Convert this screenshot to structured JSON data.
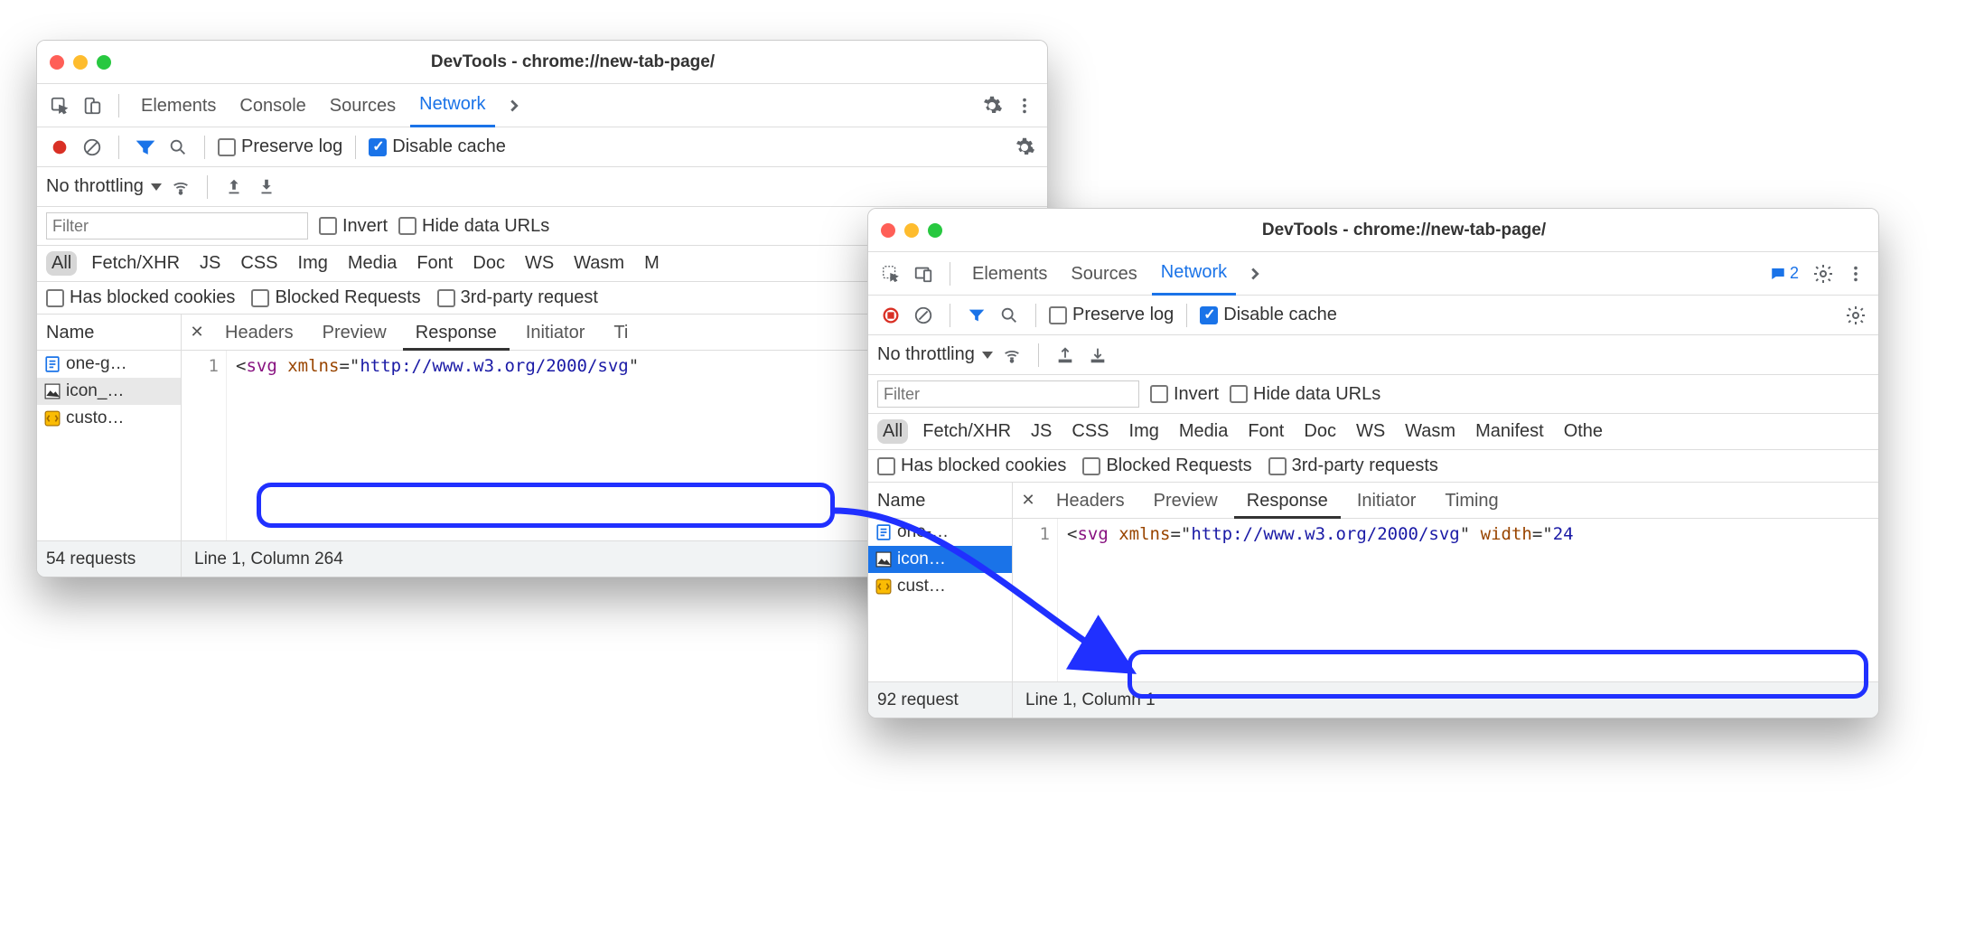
{
  "windows": {
    "a": {
      "title": "DevTools - chrome://new-tab-page/",
      "tabs": {
        "elements": "Elements",
        "console": "Console",
        "sources": "Sources",
        "network": "Network"
      },
      "preserve_log": "Preserve log",
      "disable_cache": "Disable cache",
      "no_throttling": "No throttling",
      "invert": "Invert",
      "hide_data_urls": "Hide data URLs",
      "filter_placeholder": "Filter",
      "types": {
        "all": "All",
        "fetch": "Fetch/XHR",
        "js": "JS",
        "css": "CSS",
        "img": "Img",
        "media": "Media",
        "font": "Font",
        "doc": "Doc",
        "ws": "WS",
        "wasm": "Wasm",
        "m": "M"
      },
      "blocked_cookies": "Has blocked cookies",
      "blocked_requests": "Blocked Requests",
      "third_party": "3rd-party request",
      "name_header": "Name",
      "requests": [
        {
          "label": "one-g…",
          "kind": "doc"
        },
        {
          "label": "icon_…",
          "kind": "pen",
          "selected": true
        },
        {
          "label": "custo…",
          "kind": "js"
        }
      ],
      "detail_tabs": {
        "headers": "Headers",
        "preview": "Preview",
        "response": "Response",
        "initiator": "Initiator",
        "timing": "Ti"
      },
      "code_line_num": "1",
      "code_html": "&lt;<span class='ht'>svg</span> <span class='attr'>xmlns</span>=\"<span class='val'>http://www.w3.org/2000/svg</span>\"",
      "req_count": "54 requests",
      "cursor": "Line 1, Column 264"
    },
    "b": {
      "title": "DevTools - chrome://new-tab-page/",
      "tabs": {
        "elements": "Elements",
        "sources": "Sources",
        "network": "Network"
      },
      "issues_count": "2",
      "preserve_log": "Preserve log",
      "disable_cache": "Disable cache",
      "no_throttling": "No throttling",
      "invert": "Invert",
      "hide_data_urls": "Hide data URLs",
      "filter_placeholder": "Filter",
      "types": {
        "all": "All",
        "fetch": "Fetch/XHR",
        "js": "JS",
        "css": "CSS",
        "img": "Img",
        "media": "Media",
        "font": "Font",
        "doc": "Doc",
        "ws": "WS",
        "wasm": "Wasm",
        "manifest": "Manifest",
        "other": "Othe"
      },
      "blocked_cookies": "Has blocked cookies",
      "blocked_requests": "Blocked Requests",
      "third_party": "3rd-party requests",
      "name_header": "Name",
      "requests": [
        {
          "label": "one-…",
          "kind": "doc"
        },
        {
          "label": "icon…",
          "kind": "pen",
          "selected_blue": true
        },
        {
          "label": "cust…",
          "kind": "js"
        }
      ],
      "detail_tabs": {
        "headers": "Headers",
        "preview": "Preview",
        "response": "Response",
        "initiator": "Initiator",
        "timing": "Timing"
      },
      "code_line_num": "1",
      "code_html": "&lt;<span class='ht'>svg</span> <span class='attr'>xmlns</span>=\"<span class='val'>http://www.w3.org/2000/svg</span>\" <span class='attr'>width</span>=\"<span class='val'>24</span>",
      "req_count": "92 request",
      "cursor": "Line 1, Column 1"
    }
  }
}
